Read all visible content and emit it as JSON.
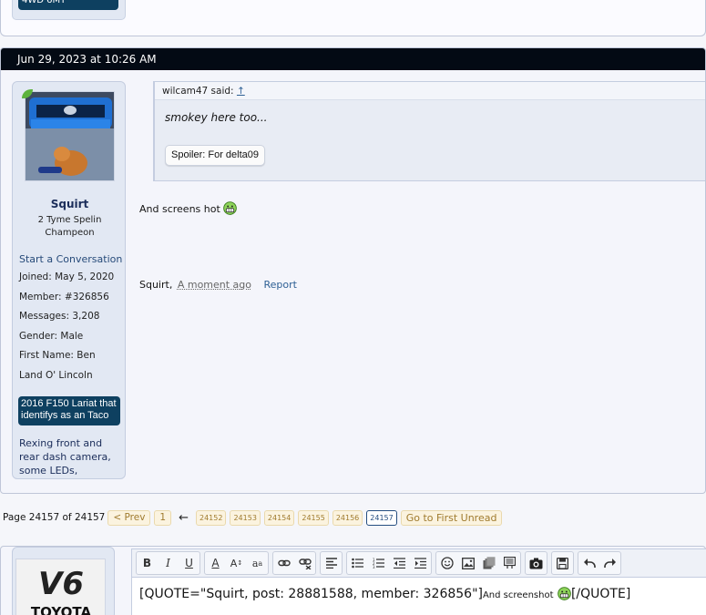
{
  "prev_post": {
    "badge": "4WD 6MT"
  },
  "post": {
    "date": "Jun 29, 2023 at 10:26 AM",
    "user": {
      "name": "Squirt",
      "title": "2 Tyme Spelin Champeon",
      "start_conversation": "Start a Conversation",
      "joined_label": "Joined:",
      "joined": "May 5, 2020",
      "member_label": "Member:",
      "member": "#326856",
      "messages_label": "Messages:",
      "messages": "3,208",
      "gender_label": "Gender:",
      "gender": "Male",
      "firstname_label": "First Name:",
      "firstname": "Ben",
      "location": "Land O' Lincoln",
      "badge": "2016 F150 Lariat that identifys as an Taco",
      "signature": "Rexing front and rear dash camera, some LEDs,"
    },
    "quote": {
      "author": "wilcam47 said:",
      "arrow": "↑",
      "text": "smokey here too...",
      "spoiler_button": "Spoiler: For delta09"
    },
    "message": "And screens hot",
    "footer": {
      "author": "Squirt,",
      "time": "A moment ago",
      "report": "Report"
    }
  },
  "pagination": {
    "label": "Page 24157 of 24157",
    "prev": "< Prev",
    "first": "1",
    "arrow": "←",
    "pages": [
      "24152",
      "24153",
      "24154",
      "24155",
      "24156",
      "24157"
    ],
    "current": "24157",
    "first_unread": "Go to First Unread"
  },
  "reply": {
    "avatar_text_top": "V6",
    "avatar_text_bottom": "TOYOTA",
    "editor_text": "[QUOTE=\"Squirt, post: 28881588, member: 326856\"]",
    "editor_small": "And screenshot",
    "editor_close": "[/QUOTE]"
  }
}
